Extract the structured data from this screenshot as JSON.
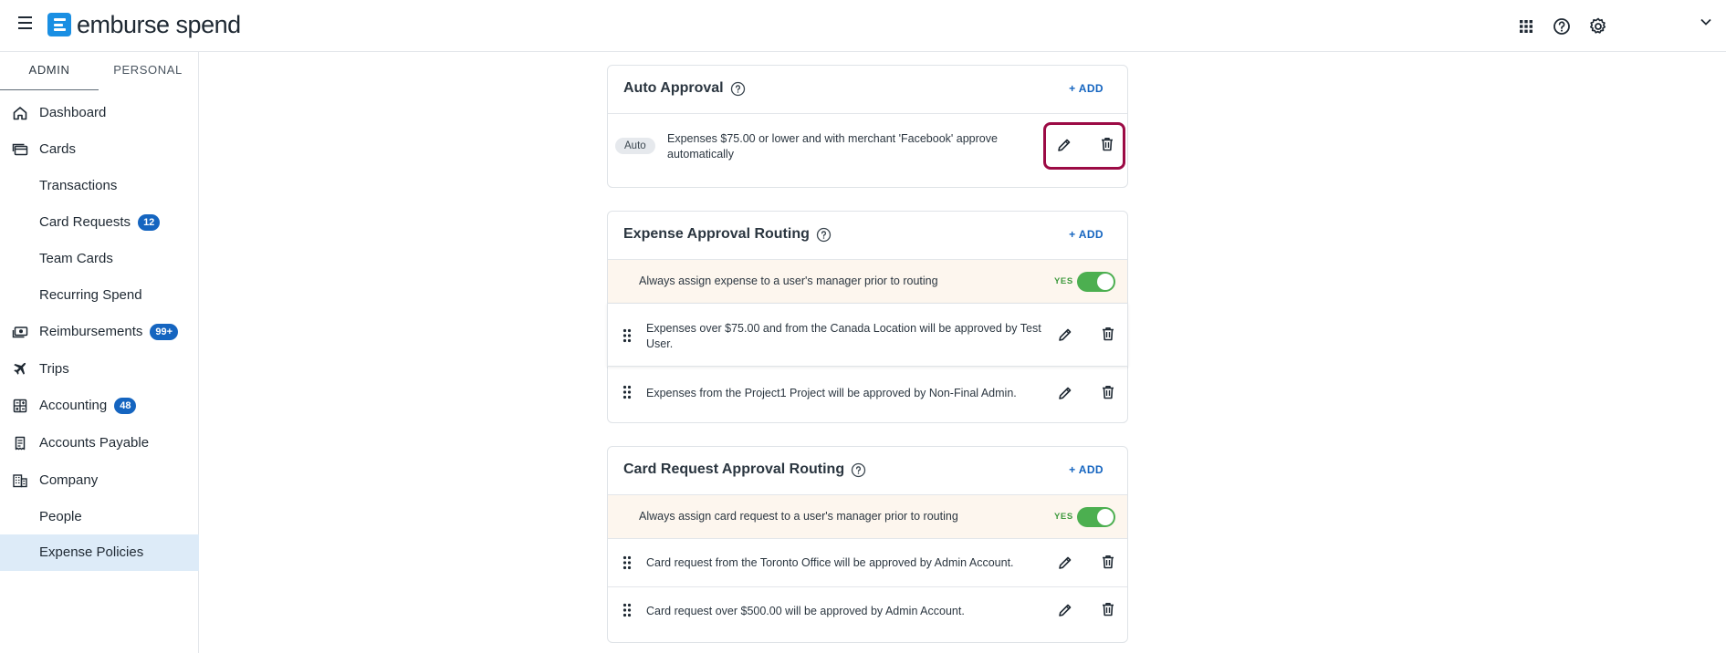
{
  "header": {
    "brand": "emburse spend"
  },
  "sidebar": {
    "tabs": [
      {
        "label": "ADMIN"
      },
      {
        "label": "PERSONAL"
      }
    ],
    "items": [
      {
        "label": "Dashboard",
        "icon": "home-icon"
      },
      {
        "label": "Cards",
        "icon": "cards-icon"
      },
      {
        "label": "Transactions"
      },
      {
        "label": "Card Requests",
        "badge": "12"
      },
      {
        "label": "Team Cards"
      },
      {
        "label": "Recurring Spend"
      },
      {
        "label": "Reimbursements",
        "icon": "cash-icon",
        "badge": "99+"
      },
      {
        "label": "Trips",
        "icon": "airplane-icon"
      },
      {
        "label": "Accounting",
        "icon": "accounting-icon",
        "badge": "48"
      },
      {
        "label": "Accounts Payable",
        "icon": "receipt-icon"
      },
      {
        "label": "Company",
        "icon": "building-icon"
      },
      {
        "label": "People"
      },
      {
        "label": "Expense Policies"
      }
    ]
  },
  "auto_approval": {
    "title": "Auto Approval",
    "add_label": "+ ADD",
    "pill": "Auto",
    "rule_text": "Expenses $75.00 or lower and with merchant 'Facebook' approve automatically"
  },
  "expense_routing": {
    "title": "Expense Approval Routing",
    "add_label": "+ ADD",
    "manager_text": "Always assign expense to a user's manager prior to routing",
    "toggle_label": "YES",
    "rules": [
      "Expenses over $75.00 and from the Canada Location will be approved by Test User.",
      "Expenses from the Project1 Project will be approved by Non-Final Admin."
    ]
  },
  "card_routing": {
    "title": "Card Request Approval Routing",
    "add_label": "+ ADD",
    "manager_text": "Always assign card request to a user's manager prior to routing",
    "toggle_label": "YES",
    "rules": [
      "Card request from the Toronto Office will be approved by Admin Account.",
      "Card request over $500.00 will be approved by Admin Account."
    ]
  },
  "colors": {
    "accent": "#1565c0",
    "brand": "#1a8fe3",
    "toggle_on": "#4caf50",
    "highlight": "#9c0b45",
    "active_nav": "#ddebf8"
  }
}
